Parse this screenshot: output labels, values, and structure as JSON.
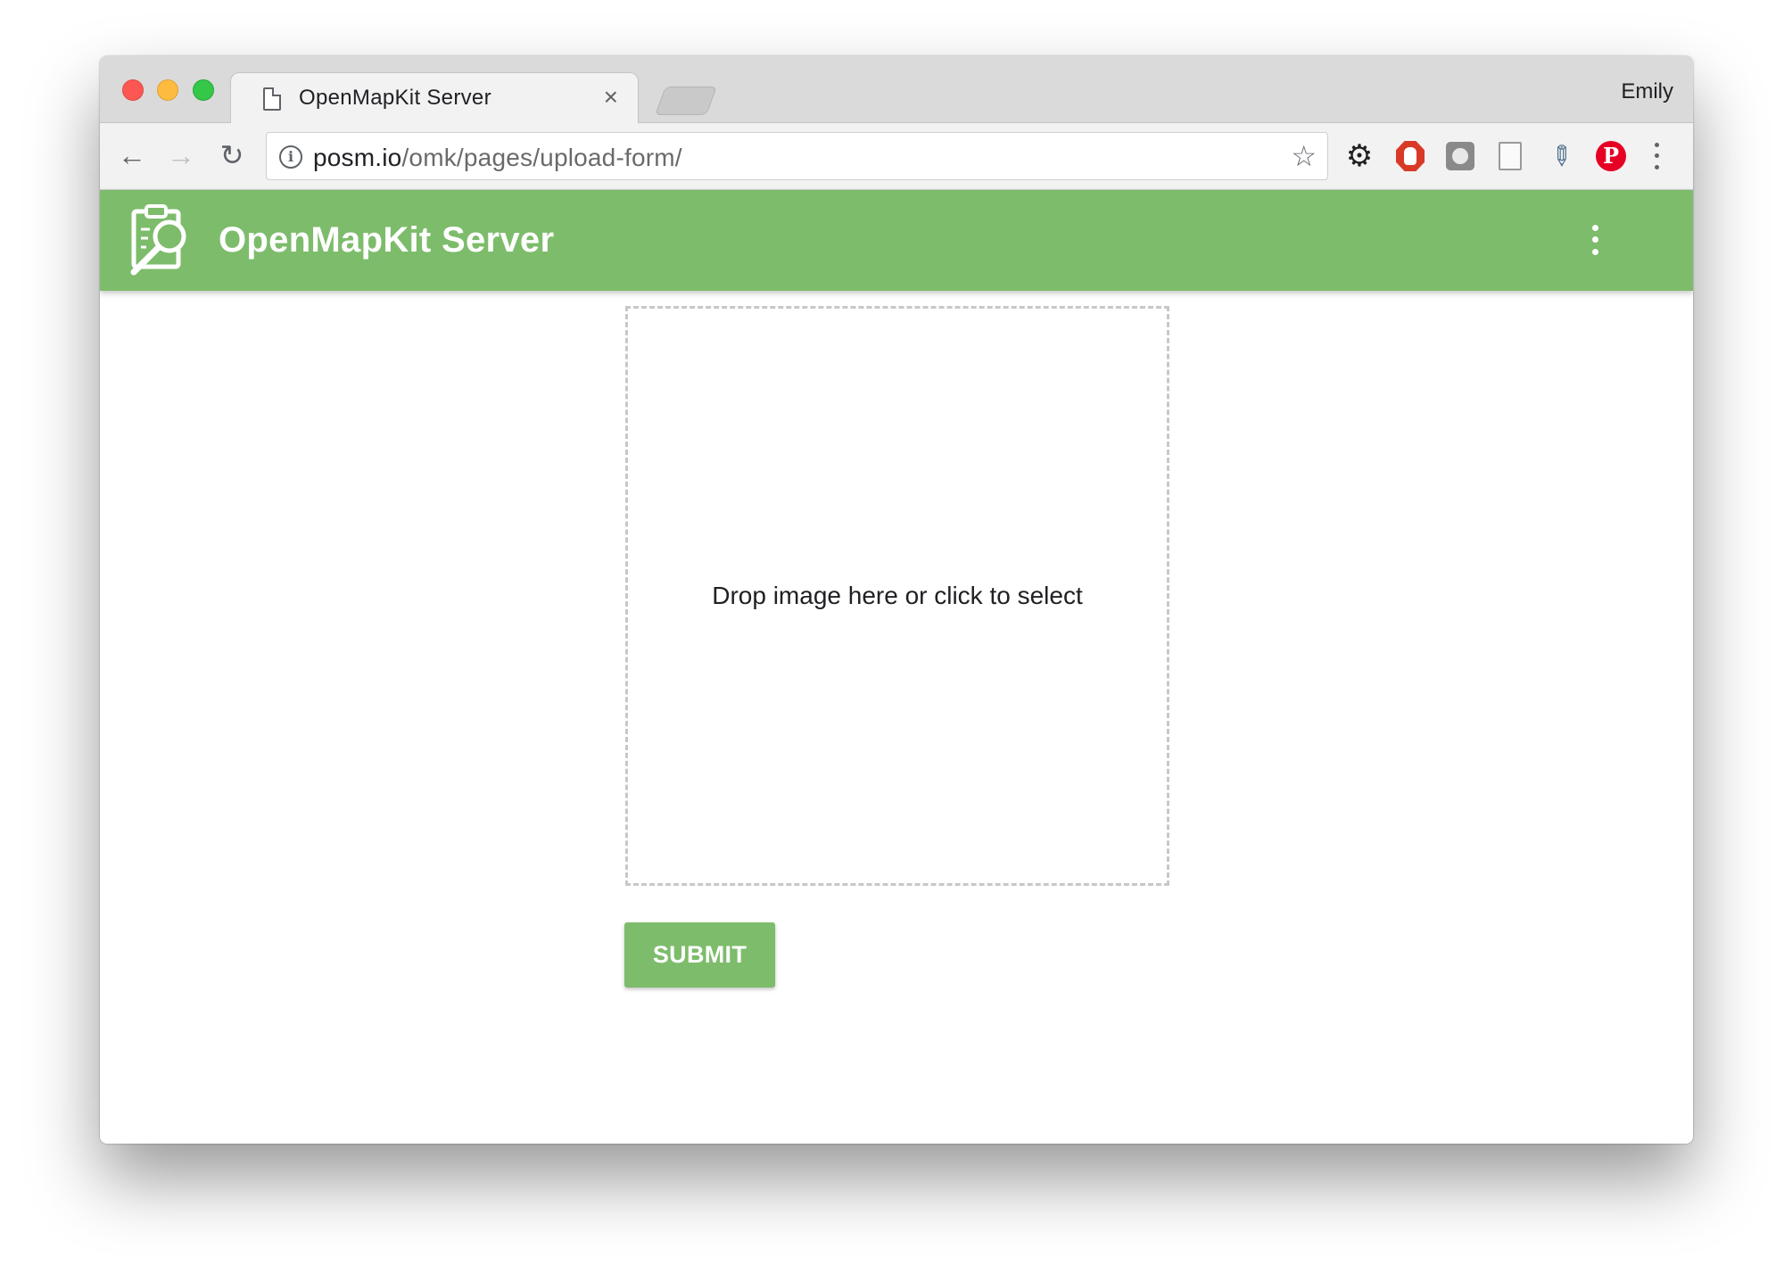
{
  "browser": {
    "tab": {
      "title": "OpenMapKit Server",
      "close_glyph": "×"
    },
    "profile_name": "Emily",
    "address_bar": {
      "url_host": "posm.io",
      "url_path": "/omk/pages/upload-form/"
    },
    "nav": {
      "back_glyph": "←",
      "forward_glyph": "→",
      "reload_glyph": "↻"
    },
    "icons": {
      "bookmark": "star-icon",
      "extensions": [
        "gear-icon",
        "stop-hand-icon",
        "ghost-icon",
        "page-icon",
        "eyedropper-icon",
        "pinterest-icon"
      ],
      "menu": "kebab-menu-icon"
    }
  },
  "app": {
    "title": "OpenMapKit Server",
    "logo": "clipboard-magnifier-logo",
    "menu_icon": "kebab-menu-icon",
    "accent_color": "#7dbc6b"
  },
  "upload_form": {
    "dropzone_text": "Drop image here or click to select",
    "submit_label": "SUBMIT"
  }
}
